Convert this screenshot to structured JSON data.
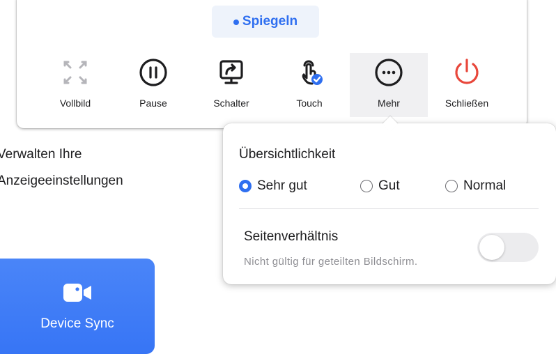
{
  "toolbar": {
    "mode_label": "Spiegeln",
    "tools": [
      {
        "id": "fullscreen",
        "label": "Vollbild",
        "icon": "fullscreen-icon"
      },
      {
        "id": "pause",
        "label": "Pause",
        "icon": "pause-icon"
      },
      {
        "id": "switch",
        "label": "Schalter",
        "icon": "screen-switch-icon"
      },
      {
        "id": "touch",
        "label": "Touch",
        "icon": "touch-icon"
      },
      {
        "id": "more",
        "label": "Mehr",
        "icon": "more-icon"
      },
      {
        "id": "close",
        "label": "Schließen",
        "icon": "power-icon"
      }
    ]
  },
  "side_text": {
    "line1": "Verwalten Ihre",
    "line2": "Anzeigeeinstellungen"
  },
  "popover": {
    "clarity_title": "Übersichtlichkeit",
    "options": [
      {
        "label": "Sehr gut",
        "selected": true
      },
      {
        "label": "Gut",
        "selected": false
      },
      {
        "label": "Normal",
        "selected": false
      }
    ],
    "aspect_title": "Seitenverhältnis",
    "aspect_note": "Nicht gültig für geteilten Bildschirm.",
    "aspect_toggle_on": false
  },
  "sync_card": {
    "label": "Device Sync",
    "icon": "video-camera-icon"
  },
  "colors": {
    "accent": "#2f6ff0",
    "danger": "#e8473b",
    "card": "#3d7bf7"
  }
}
